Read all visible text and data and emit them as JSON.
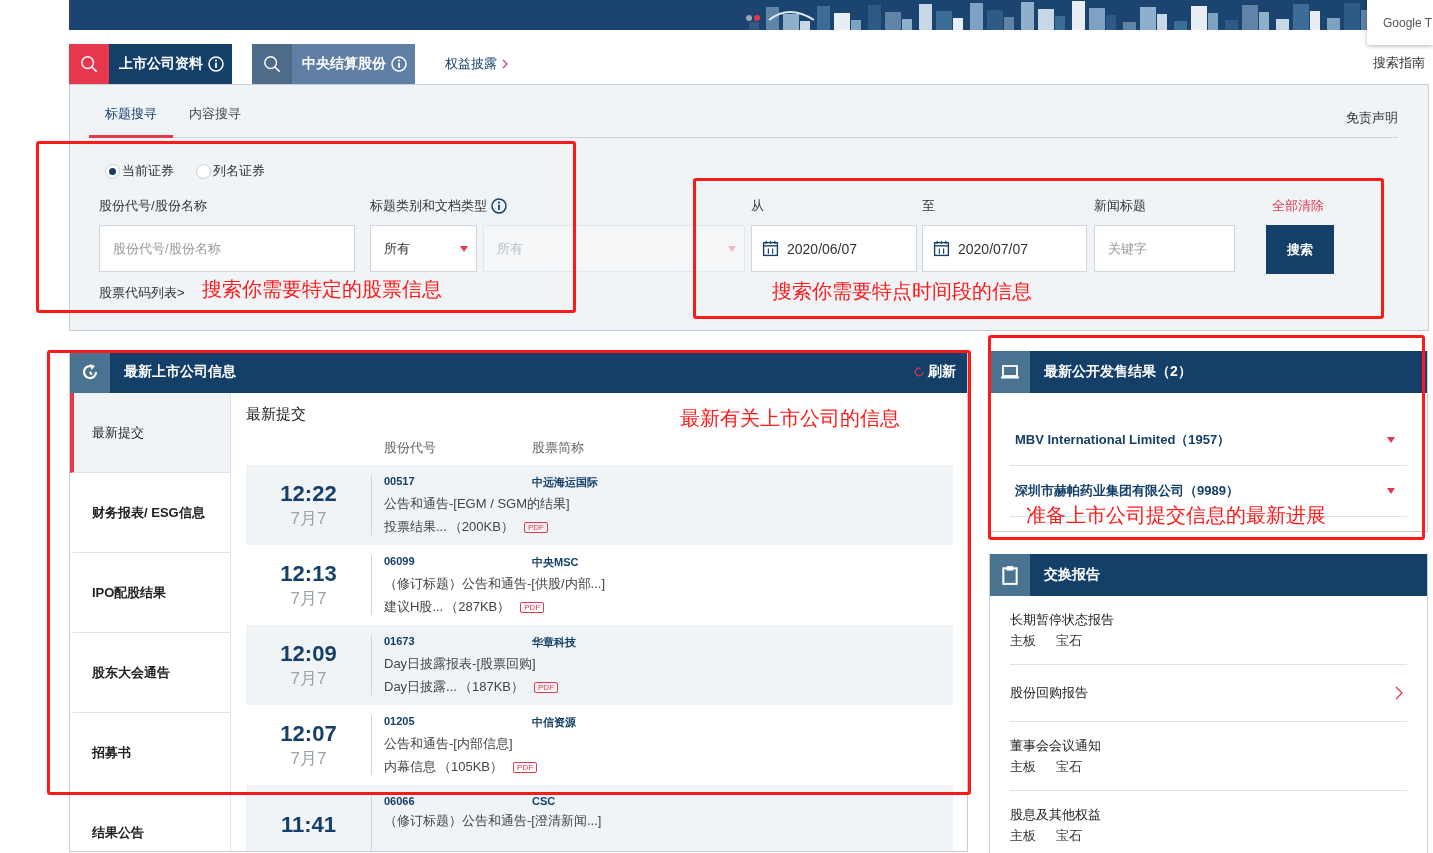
{
  "translate_popup": {
    "text": "Google T"
  },
  "search_tabs": [
    {
      "label": "上市公司资料",
      "selected": true
    },
    {
      "label": "中央结算股份",
      "selected": false
    }
  ],
  "disclosure_link": "权益披露",
  "search_guide": "搜索指南",
  "search_panel": {
    "mode_tabs": [
      {
        "label": "标题搜寻",
        "selected": true
      },
      {
        "label": "内容搜寻",
        "selected": false
      }
    ],
    "disclaimer": "免责声明",
    "security_options": [
      {
        "label": "当前证券",
        "selected": true
      },
      {
        "label": "列名证券",
        "selected": false
      }
    ],
    "stock_label": "股份代号/股份名称",
    "stock_placeholder": "股份代号/股份名称",
    "category_label": "标题类别和文档类型",
    "category_select": {
      "value": "所有",
      "disabled": false
    },
    "doc_type_select": {
      "value": "所有",
      "disabled": true
    },
    "from_label": "从",
    "from_date": "2020/06/07",
    "to_label": "至",
    "to_date": "2020/07/07",
    "headline_label": "新闻标题",
    "headline_placeholder": "关键字",
    "clear_all": "全部清除",
    "search_button": "搜索",
    "stock_list_link": "股票代码列表>"
  },
  "latest_panel": {
    "title": "最新上市公司信息",
    "refresh": "刷新",
    "categories": [
      {
        "label": "最新提交",
        "selected": true
      },
      {
        "label": "财务报表/ ESG信息",
        "selected": false
      },
      {
        "label": "IPO配股结果",
        "selected": false
      },
      {
        "label": "股东大会通告",
        "selected": false
      },
      {
        "label": "招募书",
        "selected": false
      },
      {
        "label": "结果公告",
        "selected": false
      }
    ],
    "list_title": "最新提交",
    "columns": [
      "股份代号",
      "股票简称"
    ],
    "rows": [
      {
        "time": "12:22",
        "date": "7月7",
        "code": "00517",
        "name": "中远海运国际",
        "headline": "公告和通告-[EGM / SGM的结果]",
        "doc": "投票结果...",
        "size": "（200KB）",
        "format": "PDF"
      },
      {
        "time": "12:13",
        "date": "7月7",
        "code": "06099",
        "name": "中央MSC",
        "headline": "（修订标题）公告和通告-[供股/内部...]",
        "doc": "建议H股...",
        "size": "（287KB）",
        "format": "PDF"
      },
      {
        "time": "12:09",
        "date": "7月7",
        "code": "01673",
        "name": "华章科技",
        "headline": "Day日披露报表-[股票回购]",
        "doc": "Day日披露...",
        "size": "（187KB）",
        "format": "PDF"
      },
      {
        "time": "12:07",
        "date": "7月7",
        "code": "01205",
        "name": "中信资源",
        "headline": "公告和通告-[内部信息]",
        "doc": "内幕信息",
        "size": "（105KB）",
        "format": "PDF"
      },
      {
        "time": "11:41",
        "code": "06066",
        "name": "CSC",
        "headline": "（修订标题）公告和通告-[澄清新闻...]"
      }
    ]
  },
  "ipo_panel": {
    "title": "最新公开发售结果（2）",
    "items": [
      {
        "label": "MBV International Limited（1957）",
        "expanded": false
      },
      {
        "label": "深圳市赫帕药业集团有限公司（9989）",
        "expanded": false
      }
    ]
  },
  "reports_panel": {
    "title": "交换报告",
    "items": [
      {
        "kind": "tagged",
        "title": "长期暂停状态报告",
        "tags": [
          "主板",
          "宝石"
        ]
      },
      {
        "kind": "link",
        "title": "股份回购报告"
      },
      {
        "kind": "tagged",
        "title": "董事会会议通知",
        "tags": [
          "主板",
          "宝石"
        ]
      },
      {
        "kind": "tagged",
        "title": "股息及其他权益",
        "tags": [
          "主板",
          "宝石"
        ]
      }
    ]
  },
  "annotations": [
    {
      "text": "搜索你需要特定的股票信息"
    },
    {
      "text": "搜索你需要特点时间段的信息"
    },
    {
      "text": "最新有关上市公司的信息"
    },
    {
      "text": "准备上市公司提交信息的最新进展"
    }
  ]
}
